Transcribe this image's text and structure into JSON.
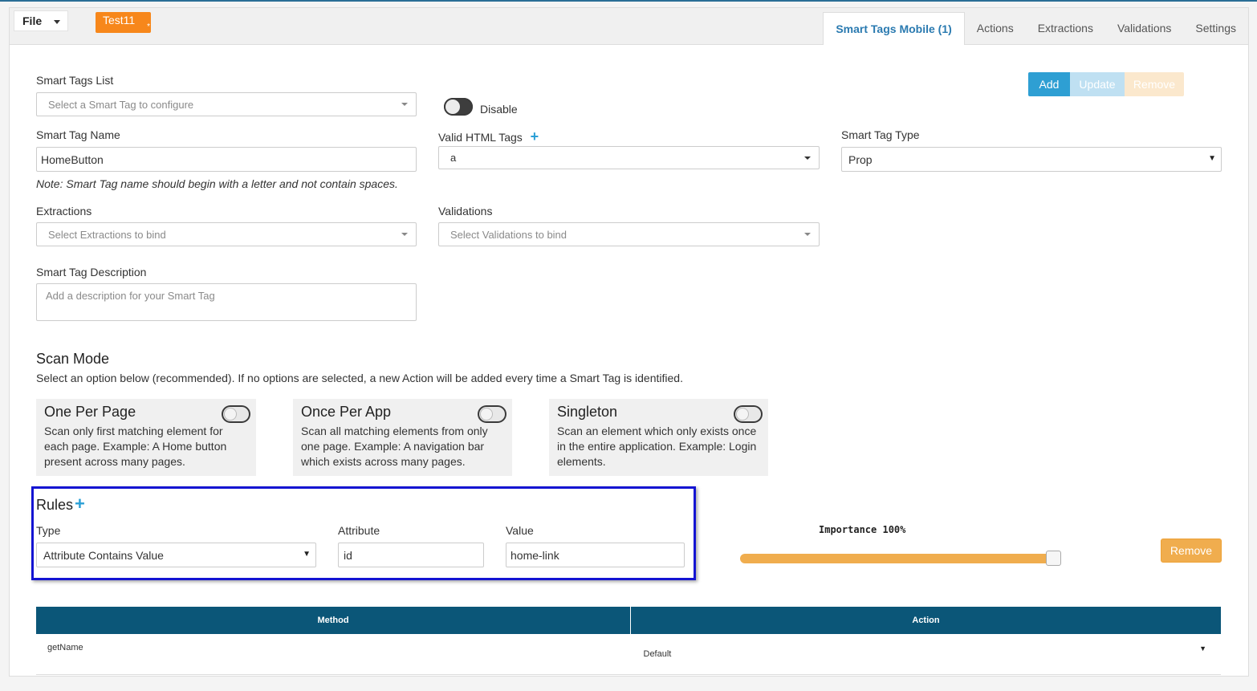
{
  "header": {
    "file_label": "File",
    "open_tab_label": "Test11",
    "open_tab_marker": "*",
    "tabs": [
      "Smart Tags Mobile (1)",
      "Actions",
      "Extractions",
      "Validations",
      "Settings"
    ]
  },
  "form": {
    "smart_tags_list_label": "Smart Tags List",
    "smart_tags_list_placeholder": "Select a Smart Tag to configure",
    "disable_label": "Disable",
    "buttons": {
      "add": "Add",
      "update": "Update",
      "remove": "Remove"
    },
    "smart_tag_name_label": "Smart Tag Name",
    "smart_tag_name_value": "HomeButton",
    "name_note": "Note: Smart Tag name should begin with a letter and not contain spaces.",
    "valid_html_tags_label": "Valid HTML Tags",
    "valid_html_tags_value": "a",
    "smart_tag_type_label": "Smart Tag Type",
    "smart_tag_type_value": "Prop",
    "extractions_label": "Extractions",
    "extractions_placeholder": "Select Extractions to bind",
    "validations_label": "Validations",
    "validations_placeholder": "Select Validations to bind",
    "description_label": "Smart Tag Description",
    "description_placeholder": "Add a description for your Smart Tag"
  },
  "scan_mode": {
    "title": "Scan Mode",
    "subtitle": "Select an option below (recommended). If no options are selected, a new Action will be added every time a Smart Tag is identified.",
    "options": [
      {
        "title": "One Per Page",
        "desc": "Scan only first matching element for each page. Example: A Home button present across many pages."
      },
      {
        "title": "Once Per App",
        "desc": "Scan all matching elements from only one page. Example: A navigation bar which exists across many pages."
      },
      {
        "title": "Singleton",
        "desc": "Scan an element which only exists once in the entire application. Example: Login elements."
      }
    ]
  },
  "rules": {
    "title": "Rules",
    "type_label": "Type",
    "type_value": "Attribute Contains Value",
    "attribute_label": "Attribute",
    "attribute_value": "id",
    "value_label": "Value",
    "value_value": "home-link",
    "importance_label": "Importance 100%",
    "importance_level": 1.0,
    "remove_label": "Remove"
  },
  "methods_table": {
    "headers": [
      "Method",
      "Action"
    ],
    "rows": [
      {
        "method": "getName",
        "action": "Default"
      }
    ]
  },
  "colors": {
    "accent_blue": "#2a9fd6",
    "orange": "#f7871b",
    "table_header": "#0b5678",
    "highlight_box": "#1414d2"
  }
}
